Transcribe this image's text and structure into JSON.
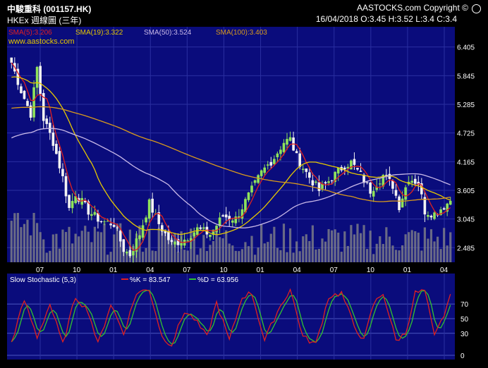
{
  "header": {
    "title": "中駿重科 (001157.HK)",
    "subtitle": "HKEx 週線圖 (三年)",
    "copyright": "AASTOCKS.com Copyright ©",
    "date_stats": "16/04/2018    O:3.45  H:3.52  L:3.4  C:3.4",
    "watermark": "www.aastocks.com"
  },
  "colors": {
    "background": "#000000",
    "panel": "#0a0c7c",
    "grid": "#2a2fa0",
    "up": "#8fe35a",
    "down": "#f2f2f2",
    "volume": "#8a8a8a",
    "sma5": "#e02020",
    "sma19": "#e6c800",
    "sma50": "#c9b9e8",
    "sma100": "#d99a1c",
    "stoch_k": "#e02020",
    "stoch_d": "#31c331"
  },
  "chart_data": [
    {
      "type": "candlestick",
      "title": "中駿重科 (001157.HK)",
      "ylim": [
        2.2,
        6.8
      ],
      "y_ticks": [
        6.405,
        5.845,
        5.285,
        4.725,
        4.165,
        3.605,
        3.045,
        2.485
      ],
      "x_ticks": [
        "07",
        "10",
        "01",
        "04",
        "07",
        "10",
        "01",
        "04",
        "07",
        "10",
        "01",
        "04"
      ],
      "legend": [
        {
          "label": "SMA(5):3.206",
          "color": "#e02020"
        },
        {
          "label": "SMA(19):3.322",
          "color": "#e6c800"
        },
        {
          "label": "SMA(50):3.524",
          "color": "#c9b9e8"
        },
        {
          "label": "SMA(100):3.403",
          "color": "#d99a1c"
        }
      ],
      "close_anchors": [
        [
          0,
          6.1
        ],
        [
          3,
          5.55
        ],
        [
          6,
          5.1
        ],
        [
          8,
          6.0
        ],
        [
          10,
          5.0
        ],
        [
          13,
          4.55
        ],
        [
          16,
          3.85
        ],
        [
          18,
          3.25
        ],
        [
          20,
          3.55
        ],
        [
          24,
          3.2
        ],
        [
          28,
          3.0
        ],
        [
          32,
          2.95
        ],
        [
          35,
          2.45
        ],
        [
          37,
          2.35
        ],
        [
          40,
          2.75
        ],
        [
          43,
          3.35
        ],
        [
          46,
          2.95
        ],
        [
          50,
          2.55
        ],
        [
          54,
          2.65
        ],
        [
          58,
          2.85
        ],
        [
          62,
          2.75
        ],
        [
          66,
          3.1
        ],
        [
          70,
          3.05
        ],
        [
          74,
          3.5
        ],
        [
          78,
          3.95
        ],
        [
          82,
          4.25
        ],
        [
          85,
          4.55
        ],
        [
          87,
          4.6
        ],
        [
          89,
          4.25
        ],
        [
          92,
          3.95
        ],
        [
          96,
          3.6
        ],
        [
          100,
          3.85
        ],
        [
          104,
          4.1
        ],
        [
          106,
          4.15
        ],
        [
          109,
          3.9
        ],
        [
          112,
          3.6
        ],
        [
          116,
          3.9
        ],
        [
          119,
          3.7
        ],
        [
          121,
          3.3
        ],
        [
          124,
          3.85
        ],
        [
          127,
          3.75
        ],
        [
          129,
          3.2
        ],
        [
          132,
          3.15
        ],
        [
          135,
          3.3
        ],
        [
          137,
          3.4
        ]
      ],
      "last_close": 3.4
    },
    {
      "type": "line",
      "title": "Slow Stochastic (5,3)",
      "ylim": [
        0,
        100
      ],
      "y_ticks": [
        70,
        50,
        30,
        0
      ],
      "series": [
        {
          "name": "%K = 83.547",
          "color": "#e02020"
        },
        {
          "name": "%D = 63.956",
          "color": "#31c331"
        }
      ],
      "k_anchors": [
        [
          0,
          18
        ],
        [
          4,
          75
        ],
        [
          8,
          25
        ],
        [
          12,
          70
        ],
        [
          16,
          15
        ],
        [
          20,
          80
        ],
        [
          24,
          60
        ],
        [
          27,
          15
        ],
        [
          31,
          70
        ],
        [
          35,
          30
        ],
        [
          39,
          85
        ],
        [
          43,
          90
        ],
        [
          47,
          25
        ],
        [
          50,
          15
        ],
        [
          54,
          60
        ],
        [
          57,
          50
        ],
        [
          61,
          25
        ],
        [
          64,
          72
        ],
        [
          68,
          20
        ],
        [
          72,
          80
        ],
        [
          75,
          85
        ],
        [
          79,
          20
        ],
        [
          83,
          60
        ],
        [
          87,
          90
        ],
        [
          91,
          25
        ],
        [
          95,
          15
        ],
        [
          99,
          80
        ],
        [
          103,
          85
        ],
        [
          107,
          40
        ],
        [
          110,
          20
        ],
        [
          113,
          70
        ],
        [
          116,
          85
        ],
        [
          120,
          20
        ],
        [
          123,
          30
        ],
        [
          126,
          85
        ],
        [
          129,
          88
        ],
        [
          132,
          25
        ],
        [
          135,
          55
        ],
        [
          137,
          83.5
        ]
      ]
    }
  ]
}
